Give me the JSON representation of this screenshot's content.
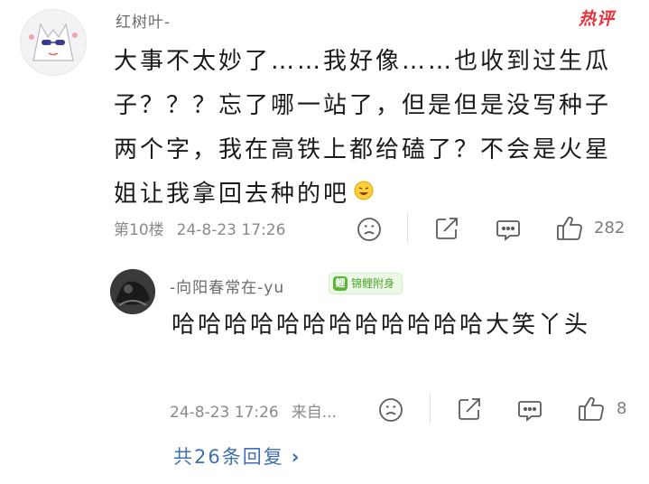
{
  "hot_badge": "热评",
  "comment": {
    "username": "红树叶-",
    "text": "大事不太妙了……我好像……也收到过生瓜子？？？忘了哪一站了，但是但是没写种子两个字，我在高铁上都给磕了？不会是火星姐让我拿回去种的吧",
    "floor": "第10楼",
    "time": "24-8-23 17:26",
    "likes": "282"
  },
  "reply": {
    "username": "-向阳春常在-yu",
    "badge": "锦鲤附身",
    "text": "哈哈哈哈哈哈哈哈哈哈哈哈大笑丫头",
    "time": "24-8-23 17:26",
    "source": "来自...",
    "likes": "8"
  },
  "replies_link": "共26条回复",
  "icons": {
    "dislike": "dislike-face-icon",
    "share": "share-icon",
    "comment": "comment-icon",
    "like": "thumbs-up-icon",
    "chevron": "chevron-right-icon",
    "emoji": "laughing-emoji-icon"
  },
  "colors": {
    "hot": "#e8323c",
    "link": "#3f6fb4",
    "badge_green": "#57b635"
  }
}
